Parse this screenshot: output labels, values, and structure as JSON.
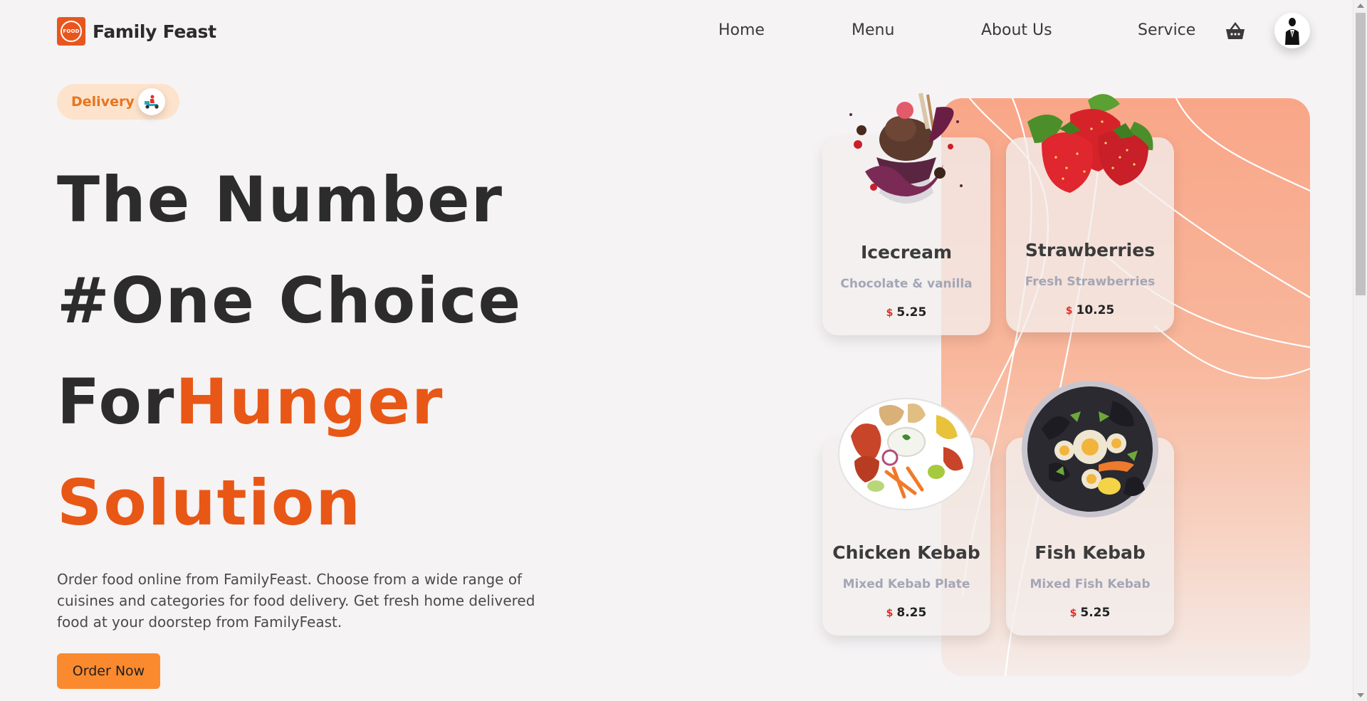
{
  "brand": {
    "name": "Family Feast",
    "logo_icon": "food-logo-icon",
    "logo_mark_text": "FOOD",
    "accent_color": "#e85716"
  },
  "nav": {
    "items": [
      {
        "label": "Home"
      },
      {
        "label": "Menu"
      },
      {
        "label": "About Us"
      },
      {
        "label": "Service"
      }
    ],
    "cart_icon": "basket-icon",
    "avatar_icon": "user-avatar-icon"
  },
  "hero": {
    "badge": {
      "label": "Delivery",
      "icon": "scooter-icon"
    },
    "headline": {
      "line1": "The Number",
      "line2": "#One Choice",
      "line3_dark": "For",
      "line3_orange": "Hunger",
      "line4": "Solution"
    },
    "description": "Order food online from FamilyFeast. Choose from a wide range of cuisines and categories for food delivery. Get fresh home delivered food at your doorstep from FamilyFeast.",
    "cta_label": "Order Now",
    "cta_color": "#fb8a2e"
  },
  "products": [
    {
      "name": "Icecream",
      "description": "Chocolate & vanilla",
      "currency": "$",
      "price": "5.25",
      "image": "icecream-sundae-image"
    },
    {
      "name": "Strawberries",
      "description": "Fresh Strawberries",
      "currency": "$",
      "price": "10.25",
      "image": "strawberries-image"
    },
    {
      "name": "Chicken Kebab",
      "description": "Mixed Kebab Plate",
      "currency": "$",
      "price": "8.25",
      "image": "chicken-kebab-plate-image"
    },
    {
      "name": "Fish Kebab",
      "description": "Mixed Fish Kebab",
      "currency": "$",
      "price": "5.25",
      "image": "seafood-platter-image"
    }
  ],
  "colors": {
    "panel_gradient_top": "#f9a688",
    "panel_gradient_bottom": "#f5ece9",
    "price_currency": "#e0312b"
  }
}
